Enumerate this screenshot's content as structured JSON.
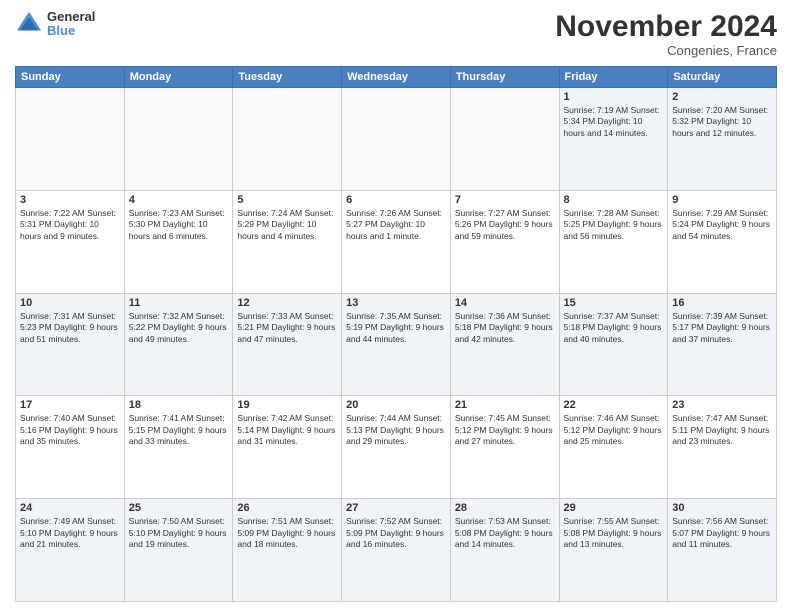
{
  "logo": {
    "general": "General",
    "blue": "Blue"
  },
  "title": "November 2024",
  "location": "Congenies, France",
  "days_of_week": [
    "Sunday",
    "Monday",
    "Tuesday",
    "Wednesday",
    "Thursday",
    "Friday",
    "Saturday"
  ],
  "weeks": [
    [
      {
        "day": "",
        "info": ""
      },
      {
        "day": "",
        "info": ""
      },
      {
        "day": "",
        "info": ""
      },
      {
        "day": "",
        "info": ""
      },
      {
        "day": "",
        "info": ""
      },
      {
        "day": "1",
        "info": "Sunrise: 7:19 AM\nSunset: 5:34 PM\nDaylight: 10 hours and 14 minutes."
      },
      {
        "day": "2",
        "info": "Sunrise: 7:20 AM\nSunset: 5:32 PM\nDaylight: 10 hours and 12 minutes."
      }
    ],
    [
      {
        "day": "3",
        "info": "Sunrise: 7:22 AM\nSunset: 5:31 PM\nDaylight: 10 hours and 9 minutes."
      },
      {
        "day": "4",
        "info": "Sunrise: 7:23 AM\nSunset: 5:30 PM\nDaylight: 10 hours and 6 minutes."
      },
      {
        "day": "5",
        "info": "Sunrise: 7:24 AM\nSunset: 5:29 PM\nDaylight: 10 hours and 4 minutes."
      },
      {
        "day": "6",
        "info": "Sunrise: 7:26 AM\nSunset: 5:27 PM\nDaylight: 10 hours and 1 minute."
      },
      {
        "day": "7",
        "info": "Sunrise: 7:27 AM\nSunset: 5:26 PM\nDaylight: 9 hours and 59 minutes."
      },
      {
        "day": "8",
        "info": "Sunrise: 7:28 AM\nSunset: 5:25 PM\nDaylight: 9 hours and 56 minutes."
      },
      {
        "day": "9",
        "info": "Sunrise: 7:29 AM\nSunset: 5:24 PM\nDaylight: 9 hours and 54 minutes."
      }
    ],
    [
      {
        "day": "10",
        "info": "Sunrise: 7:31 AM\nSunset: 5:23 PM\nDaylight: 9 hours and 51 minutes."
      },
      {
        "day": "11",
        "info": "Sunrise: 7:32 AM\nSunset: 5:22 PM\nDaylight: 9 hours and 49 minutes."
      },
      {
        "day": "12",
        "info": "Sunrise: 7:33 AM\nSunset: 5:21 PM\nDaylight: 9 hours and 47 minutes."
      },
      {
        "day": "13",
        "info": "Sunrise: 7:35 AM\nSunset: 5:19 PM\nDaylight: 9 hours and 44 minutes."
      },
      {
        "day": "14",
        "info": "Sunrise: 7:36 AM\nSunset: 5:18 PM\nDaylight: 9 hours and 42 minutes."
      },
      {
        "day": "15",
        "info": "Sunrise: 7:37 AM\nSunset: 5:18 PM\nDaylight: 9 hours and 40 minutes."
      },
      {
        "day": "16",
        "info": "Sunrise: 7:39 AM\nSunset: 5:17 PM\nDaylight: 9 hours and 37 minutes."
      }
    ],
    [
      {
        "day": "17",
        "info": "Sunrise: 7:40 AM\nSunset: 5:16 PM\nDaylight: 9 hours and 35 minutes."
      },
      {
        "day": "18",
        "info": "Sunrise: 7:41 AM\nSunset: 5:15 PM\nDaylight: 9 hours and 33 minutes."
      },
      {
        "day": "19",
        "info": "Sunrise: 7:42 AM\nSunset: 5:14 PM\nDaylight: 9 hours and 31 minutes."
      },
      {
        "day": "20",
        "info": "Sunrise: 7:44 AM\nSunset: 5:13 PM\nDaylight: 9 hours and 29 minutes."
      },
      {
        "day": "21",
        "info": "Sunrise: 7:45 AM\nSunset: 5:12 PM\nDaylight: 9 hours and 27 minutes."
      },
      {
        "day": "22",
        "info": "Sunrise: 7:46 AM\nSunset: 5:12 PM\nDaylight: 9 hours and 25 minutes."
      },
      {
        "day": "23",
        "info": "Sunrise: 7:47 AM\nSunset: 5:11 PM\nDaylight: 9 hours and 23 minutes."
      }
    ],
    [
      {
        "day": "24",
        "info": "Sunrise: 7:49 AM\nSunset: 5:10 PM\nDaylight: 9 hours and 21 minutes."
      },
      {
        "day": "25",
        "info": "Sunrise: 7:50 AM\nSunset: 5:10 PM\nDaylight: 9 hours and 19 minutes."
      },
      {
        "day": "26",
        "info": "Sunrise: 7:51 AM\nSunset: 5:09 PM\nDaylight: 9 hours and 18 minutes."
      },
      {
        "day": "27",
        "info": "Sunrise: 7:52 AM\nSunset: 5:09 PM\nDaylight: 9 hours and 16 minutes."
      },
      {
        "day": "28",
        "info": "Sunrise: 7:53 AM\nSunset: 5:08 PM\nDaylight: 9 hours and 14 minutes."
      },
      {
        "day": "29",
        "info": "Sunrise: 7:55 AM\nSunset: 5:08 PM\nDaylight: 9 hours and 13 minutes."
      },
      {
        "day": "30",
        "info": "Sunrise: 7:56 AM\nSunset: 5:07 PM\nDaylight: 9 hours and 11 minutes."
      }
    ]
  ]
}
